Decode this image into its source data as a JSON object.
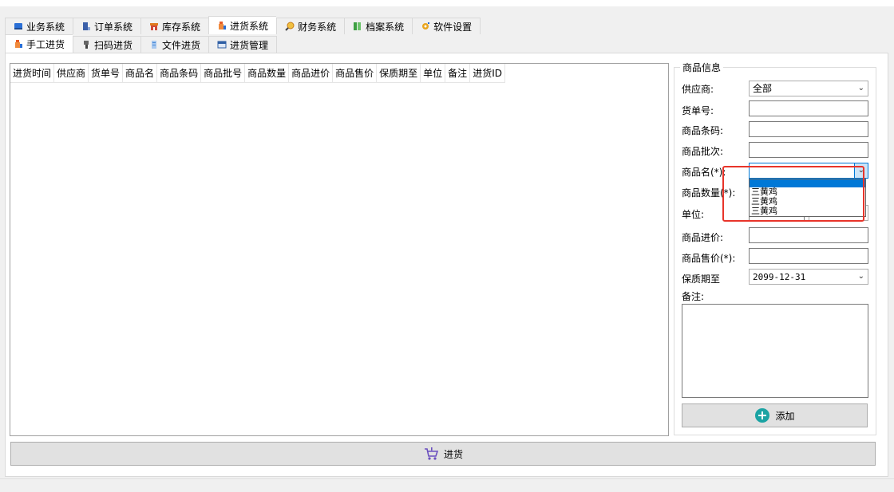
{
  "main_tabs": [
    {
      "label": "业务系统",
      "icon": "book-icon",
      "color": "#2a6fd6",
      "active": false
    },
    {
      "label": "订单系统",
      "icon": "document-icon",
      "color": "#3b5fa8",
      "active": false
    },
    {
      "label": "库存系统",
      "icon": "store-icon",
      "color": "#e07a1f",
      "active": false
    },
    {
      "label": "进货系统",
      "icon": "bottle-icon",
      "color": "#e85b24",
      "active": true
    },
    {
      "label": "财务系统",
      "icon": "magnifier-icon",
      "color": "#c77d1a",
      "active": false
    },
    {
      "label": "档案系统",
      "icon": "archive-icon",
      "color": "#3ea043",
      "active": false
    },
    {
      "label": "软件设置",
      "icon": "gear-icon",
      "color": "#e8a520",
      "active": false
    }
  ],
  "sub_tabs": [
    {
      "label": "手工进货",
      "icon": "bottle-icon",
      "color": "#e85b24",
      "active": true
    },
    {
      "label": "扫码进货",
      "icon": "scanner-icon",
      "color": "#555555",
      "active": false
    },
    {
      "label": "文件进货",
      "icon": "file-icon",
      "color": "#4a8bd6",
      "active": false
    },
    {
      "label": "进货管理",
      "icon": "window-icon",
      "color": "#2f5fa5",
      "active": false
    }
  ],
  "grid": {
    "columns": [
      "进货时间",
      "供应商",
      "货单号",
      "商品名",
      "商品条码",
      "商品批号",
      "商品数量",
      "商品进价",
      "商品售价",
      "保质期至",
      "单位",
      "备注",
      "进货ID"
    ],
    "rows": []
  },
  "form": {
    "group_title": "商品信息",
    "supplier_label": "供应商:",
    "supplier_value": "全部",
    "order_no_label": "货单号:",
    "order_no_value": "",
    "barcode_label": "商品条码:",
    "barcode_value": "",
    "batch_label": "商品批次:",
    "batch_value": "",
    "name_label": "商品名(*):",
    "name_value": "",
    "name_options": [
      "三黄鸡",
      "三黄鸡",
      "三黄鸡"
    ],
    "qty_label": "商品数量(*):",
    "unit_label": "单位:",
    "cost_label": "商品进价:",
    "cost_value": "",
    "price_label": "商品售价(*):",
    "price_value": "",
    "expiry_label": "保质期至",
    "expiry_value": "2099-12-31",
    "notes_label": "备注:",
    "notes_value": "",
    "add_button": "添加"
  },
  "purchase_button": "进货",
  "colors": {
    "highlight": "#e8342a",
    "selection": "#0078d7",
    "add_icon": "#1aa3a3",
    "cart_icon": "#6b4fbf"
  }
}
